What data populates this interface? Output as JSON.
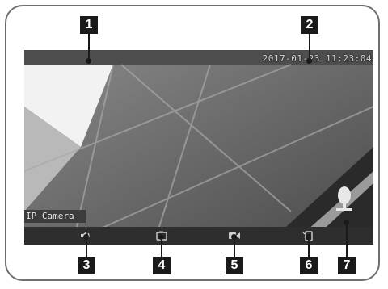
{
  "camera": {
    "timestamp": "2017-01-23 11:23:04",
    "label": "IP Camera"
  },
  "toolbar": {
    "buttons": [
      {
        "icon": "speaker-icon"
      },
      {
        "icon": "snapshot-icon"
      },
      {
        "icon": "record-icon"
      },
      {
        "icon": "rotate-icon"
      }
    ],
    "mic": {
      "icon": "microphone-icon"
    }
  },
  "callouts": [
    "1",
    "2",
    "3",
    "4",
    "5",
    "6",
    "7"
  ],
  "colors": {
    "frame": "#6f6f6f",
    "callout": "#1a1a1a"
  }
}
